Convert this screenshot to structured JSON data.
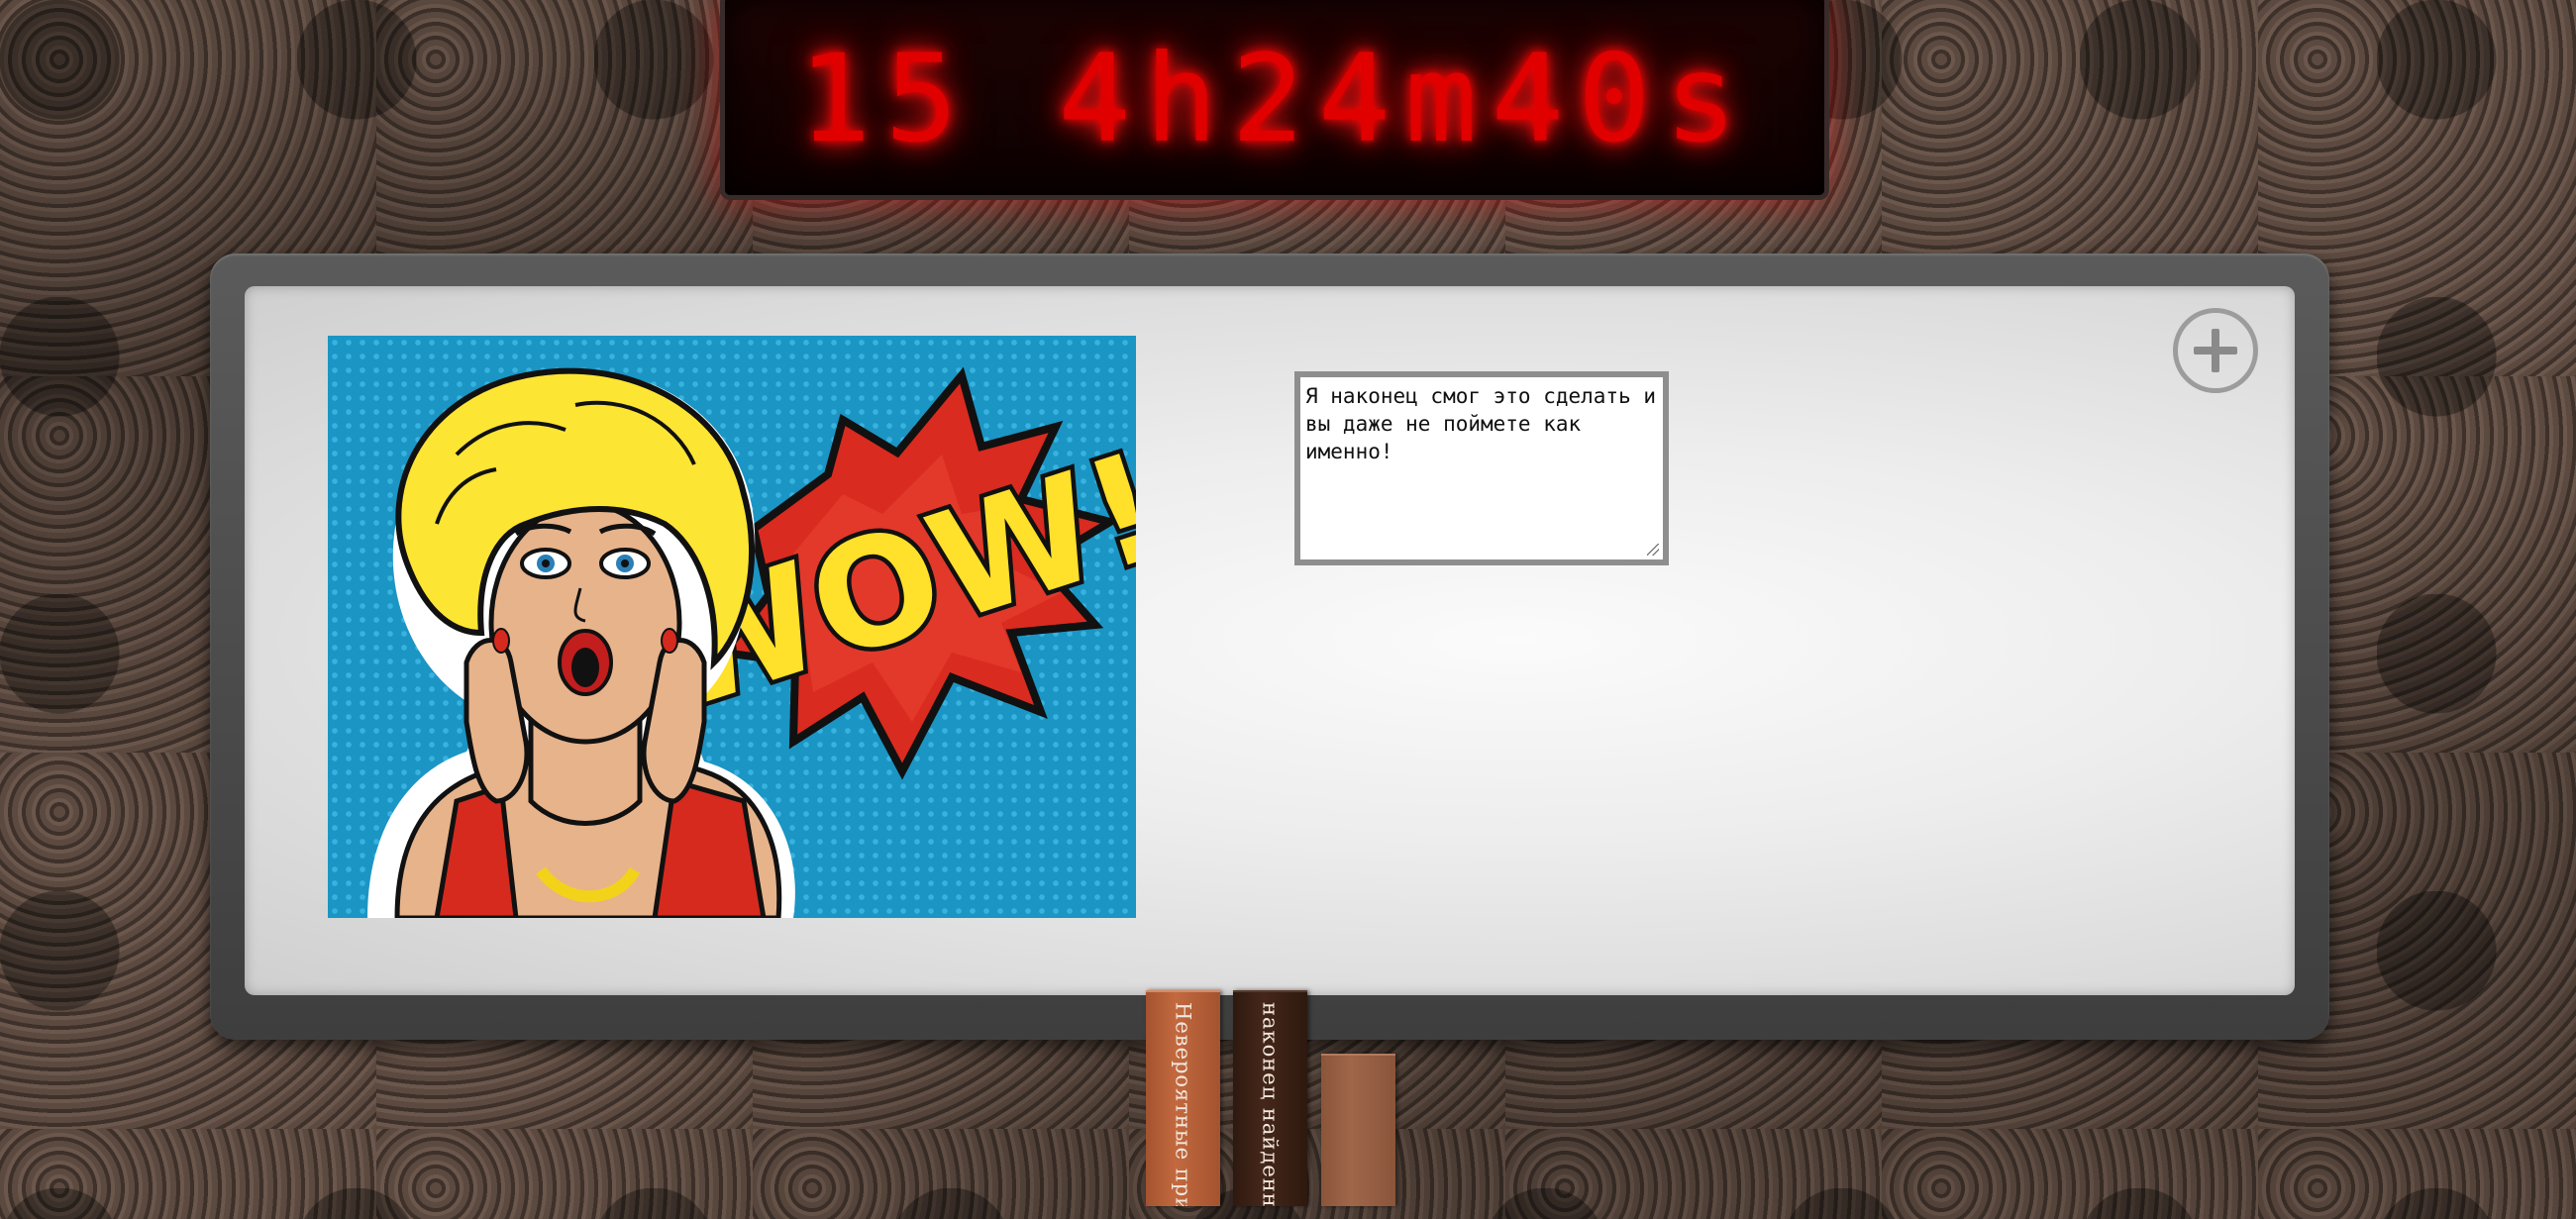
{
  "timer": {
    "display": "15 4h24m40s"
  },
  "note": {
    "text": "Я наконец смог это сделать и вы даже не поймете как именно!"
  },
  "image": {
    "caption_art": "WOW!"
  },
  "add_button": {
    "icon": "plus-circle-icon"
  },
  "books": [
    {
      "title": "Невероятные прикл"
    },
    {
      "title": "наконец найденные"
    },
    {
      "title": ""
    }
  ],
  "colors": {
    "led": "#e00000",
    "board": "#ececec",
    "frame": "#4a4a4a"
  }
}
